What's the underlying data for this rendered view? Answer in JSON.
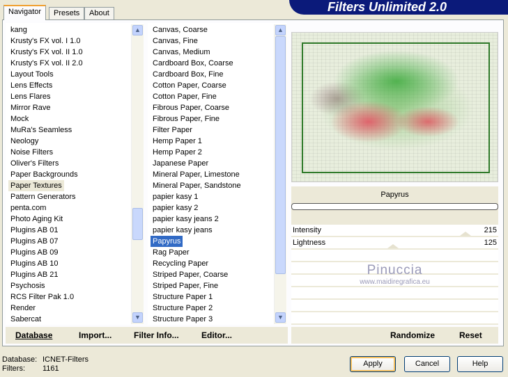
{
  "title": "Filters Unlimited 2.0",
  "tabs": [
    {
      "label": "Navigator",
      "active": true
    },
    {
      "label": "Presets"
    },
    {
      "label": "About"
    }
  ],
  "categories": {
    "items": [
      "kang",
      "Krusty's FX vol. I 1.0",
      "Krusty's FX vol. II 1.0",
      "Krusty's FX vol. II 2.0",
      "Layout Tools",
      "Lens Effects",
      "Lens Flares",
      "Mirror Rave",
      "Mock",
      "MuRa's Seamless",
      "Neology",
      "Noise Filters",
      "Oliver's Filters",
      "Paper Backgrounds",
      "Paper Textures",
      "Pattern Generators",
      "penta.com",
      "Photo Aging Kit",
      "Plugins AB 01",
      "Plugins AB 07",
      "Plugins AB 09",
      "Plugins AB 10",
      "Plugins AB 21",
      "Psychosis",
      "RCS Filter Pak 1.0",
      "Render",
      "Sabercat"
    ],
    "selected": "Paper Textures"
  },
  "filters": {
    "items": [
      "Canvas, Coarse",
      "Canvas, Fine",
      "Canvas, Medium",
      "Cardboard Box, Coarse",
      "Cardboard Box, Fine",
      "Cotton Paper, Coarse",
      "Cotton Paper, Fine",
      "Fibrous Paper, Coarse",
      "Fibrous Paper, Fine",
      "Filter Paper",
      "Hemp Paper 1",
      "Hemp Paper 2",
      "Japanese Paper",
      "Mineral Paper, Limestone",
      "Mineral Paper, Sandstone",
      "papier kasy 1",
      "papier kasy 2",
      "papier kasy jeans 2",
      "papier kasy jeans",
      "Papyrus",
      "Rag Paper",
      "Recycling Paper",
      "Striped Paper, Coarse",
      "Striped Paper, Fine",
      "Structure Paper 1",
      "Structure Paper 2",
      "Structure Paper 3"
    ],
    "selected": "Papyrus"
  },
  "filter_name": "Papyrus",
  "params": [
    {
      "label": "Intensity",
      "value": 215
    },
    {
      "label": "Lightness",
      "value": 125
    }
  ],
  "watermark": {
    "name": "Pinuccia",
    "url": "www.maidiregrafica.eu"
  },
  "bottom": {
    "database": "Database",
    "import": "Import...",
    "filter_info": "Filter Info...",
    "editor": "Editor...",
    "randomize": "Randomize",
    "reset": "Reset"
  },
  "status": {
    "database_label": "Database:",
    "database_value": "ICNET-Filters",
    "filters_label": "Filters:",
    "filters_value": "1161"
  },
  "buttons": {
    "apply": "Apply",
    "cancel": "Cancel",
    "help": "Help"
  },
  "colors": {
    "banner": "#0b1a7a",
    "selection": "#316ac5"
  }
}
